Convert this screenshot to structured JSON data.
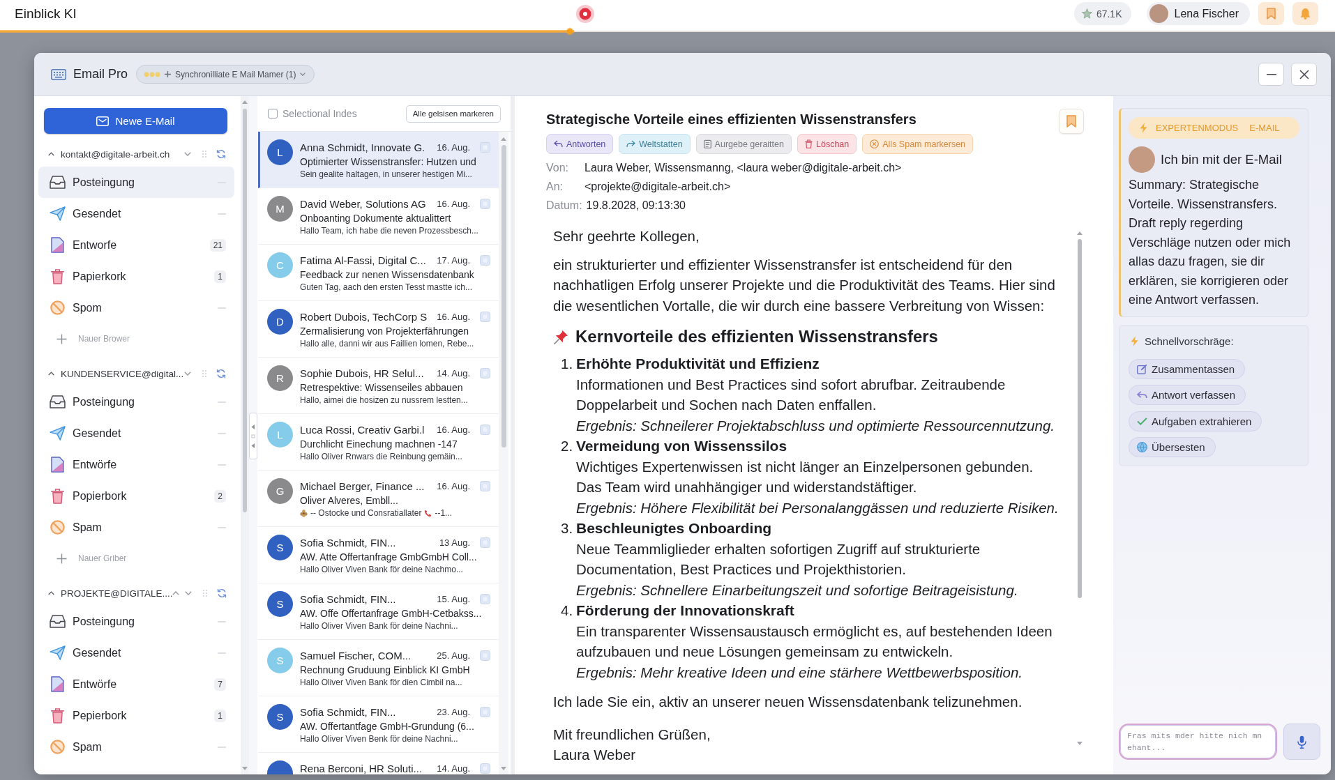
{
  "top_bar": {
    "title": "Einblick KI",
    "progress": {
      "level": 0.43
    },
    "credits": "67.1K",
    "user": {
      "name": "Lena Fischer"
    }
  },
  "window": {
    "title": "Email Pro",
    "sync_status": "Synchronilliate E Mail Mamer (1)"
  },
  "sidebar": {
    "compose_button": "Newe E-Mail",
    "accounts": [
      {
        "address": "kontakt@digitale-arbeit.ch",
        "expanded": true,
        "up_button": false,
        "folders": [
          {
            "name": "Posteingung",
            "kind": "inbox",
            "selected": true
          },
          {
            "name": "Gesendet",
            "kind": "sent",
            "selected": false
          },
          {
            "name": "Entworfe",
            "kind": "drafts",
            "count": "21",
            "selected": false
          },
          {
            "name": "Papierkork",
            "kind": "trash",
            "count": "1",
            "selected": false
          },
          {
            "name": "Spom",
            "kind": "spam",
            "selected": false
          }
        ],
        "add_folder": "Nauer Brower"
      },
      {
        "address": "KUNDENSERVICE@digital...",
        "expanded": true,
        "up_button": false,
        "folders": [
          {
            "name": "Posteingung",
            "kind": "inbox",
            "selected": false
          },
          {
            "name": "Gesendet",
            "kind": "sent",
            "selected": false
          },
          {
            "name": "Entwörfe",
            "kind": "drafts",
            "selected": false
          },
          {
            "name": "Popierbork",
            "kind": "trash",
            "count": "2",
            "selected": false
          },
          {
            "name": "Spam",
            "kind": "spam",
            "selected": false
          }
        ],
        "add_folder": "Nauer Griber"
      },
      {
        "address": "PROJEKTE@DIGITALE....",
        "expanded": true,
        "up_button": true,
        "folders": [
          {
            "name": "Posteingung",
            "kind": "inbox",
            "selected": false
          },
          {
            "name": "Gesendet",
            "kind": "sent",
            "selected": false
          },
          {
            "name": "Entwörfe",
            "kind": "drafts",
            "count": "7",
            "selected": false
          },
          {
            "name": "Pepierbork",
            "kind": "trash",
            "count": "1",
            "selected": false
          },
          {
            "name": "Spam",
            "kind": "spam",
            "selected": false
          }
        ]
      }
    ]
  },
  "email_list": {
    "select_all": {
      "label": "Selectional Indes",
      "checked": false
    },
    "mark_all_button": "Alle gelsisen markeren",
    "emails": [
      {
        "initial": "L",
        "color": "#3060c0",
        "sender": "Anna Schmidt, Innovate G.",
        "date": "16. Aug.",
        "subject": "Optimierter Wissenstransfer: Hutzen und",
        "preview": "Sein gealite haltagen, in unserer hestigen Mi...",
        "kind": "plain",
        "selected": true
      },
      {
        "initial": "M",
        "color": "#8a8a8c",
        "sender": "David Weber, Solutions AG",
        "date": "16. Aug.",
        "subject": "Onboanting Dokumente aktualittert",
        "preview": "Hallo Team, ich habe die neven Prozessbesch...",
        "kind": "plain",
        "selected": false
      },
      {
        "initial": "C",
        "color": "#84cce9",
        "sender": "Fatima Al-Fassi, Digital C...",
        "date": "17. Aug.",
        "subject": "Feedback zur nenen Wissensdatenbank",
        "preview": "Guten Tag, aach den ersten Tesst mastte ich...",
        "kind": "plain",
        "selected": false
      },
      {
        "initial": "D",
        "color": "#3060c0",
        "sender": "Robert Dubois, TechCorp S",
        "date": "16. Aug.",
        "subject": "Zermalisierung von Projekterfährungen",
        "preview": "Hallo alle, danni wir aus Faillien lomen, Rebe...",
        "kind": "plain",
        "selected": false
      },
      {
        "initial": "R",
        "color": "#8a8a8c",
        "sender": "Sophie Dubois, HR Selul...",
        "date": "14. Aug.",
        "subject": "Retrespektive: Wissenseiles abbauen",
        "preview": "Hallo, aimei die hosizen zu nussrem lestten...",
        "kind": "plain",
        "selected": false
      },
      {
        "initial": "L",
        "color": "#84cce9",
        "sender": "Luca Rossi, Creativ Garbi.l",
        "date": "16. Aug.",
        "subject": "Durchlicht Einechung machnen -147",
        "preview": "Hallo Oliver Rnwars die Reinbung gemäin...",
        "kind": "plain",
        "selected": false
      },
      {
        "initial": "G",
        "color": "#8a8a8c",
        "sender": "Michael Berger, Finance ...",
        "date": "16. Aug.",
        "subject": "Oliver Alveres, Embll...",
        "preview": "-- Ostocke und Consratiallater",
        "preview_end": "--1...",
        "kind": "icons",
        "selected": false
      },
      {
        "initial": "S",
        "color": "#3060c0",
        "sender": "Sofia Schmidt, FIN...",
        "date": "13 Aug.",
        "subject": "AW. Atte Offertanfrage GmbGmbH Coll...",
        "preview": "Hallo Oliver Viven Bank för deine Nachmo...",
        "kind": "plain",
        "selected": false
      },
      {
        "initial": "S",
        "color": "#3060c0",
        "sender": "Sofia Schmidt, FIN...",
        "date": "15. Aug.",
        "subject": "AW. Offe Offertanfrage GmbH-Cetbakss...",
        "preview": "Hallo Oliver Viven Bank för deine Nachni...",
        "kind": "plain",
        "selected": false
      },
      {
        "initial": "S",
        "color": "#84cce9",
        "sender": "Samuel Fischer, COM...",
        "date": "25. Aug.",
        "subject": "Rechnung Gruduung Einblick KI GmbH",
        "preview": "Hallo Oliver Viven Bank för dien Cimbil na...",
        "kind": "plain",
        "selected": false
      },
      {
        "initial": "S",
        "color": "#3060c0",
        "sender": "Sofia Schmidt, FIN...",
        "date": "23. Aug.",
        "subject": "AW. Offertantfage GmbH-Grundung (6...",
        "preview": "Hallo Oliver Viven Benk för deine Nachni...",
        "kind": "plain",
        "selected": false
      },
      {
        "color": "#3060c0",
        "sender": "Rena Berconi, HR Soluti...",
        "date": "14. Aug.",
        "selected": false
      }
    ]
  },
  "message": {
    "subject": "Strategische Vorteile eines effizienten Wissenstransfers",
    "actions": [
      {
        "label": "Antworten",
        "kind": "reply"
      },
      {
        "label": "Weltstatten",
        "kind": "forward"
      },
      {
        "label": "Aurgebe geraitten",
        "kind": "task"
      },
      {
        "label": "Löschan",
        "kind": "delete"
      },
      {
        "label": "Alls Spam markersen",
        "kind": "spam"
      }
    ],
    "headers": [
      {
        "label": "Von:",
        "value": "Laura Weber, Wissensmanng, <laura weber@digitale-arbeit.ch>"
      },
      {
        "label": "An:",
        "value": "<projekte@digitale-arbeit.ch>"
      },
      {
        "label": "Datum:",
        "value": "19.8.2028, 09:13:30"
      }
    ],
    "body": {
      "greeting": "Sehr geehrte Kollegen,",
      "intro": "ein strukturierter und effizienter Wissenstransfer ist entscheidend für den nachhatligen Erfolg unserer Projekte und die Produktivität des Teams. Hier sind die wesentlichen Vortalle, die wir durch eine bassere Verbreitung von Wissen:",
      "heading": "Kernvorteile des effizienten Wissenstransfers",
      "points": [
        {
          "number": "1.",
          "title": "Erhöhte Produktivität und Effizienz",
          "text": "Informationen und Best Practices sind sofort abrufbar. Zeitraubende Doppelarbeit und Sochen nach Daten enffallen.",
          "result": "Ergebnis: Schneilerer Projektabschluss und optimierte Ressourcennutzung."
        },
        {
          "number": "2.",
          "title": "Vermeidung von Wissenssilos",
          "text": "Wichtiges Expertenwissen ist nicht länger an Einzelpersonen gebunden. Das Team wird unahhängiger und widerstandstäftiger.",
          "result": "Ergebnis: Höhere Flexibilität bei Personalanggässen und reduzierte Risiken."
        },
        {
          "number": "3.",
          "title": "Beschleunigtes Onboarding",
          "text": "Neue Teammliglieder erhalten sofortigen Zugriff auf strukturierte Documentation, Best Practices und Projekthistorien.",
          "result": "Ergebnis: Schnellere Einarbeitungszeit und sofortige Beitrageisistung."
        },
        {
          "number": "4.",
          "title": "Förderung der Innovationskraft",
          "text": "Ein transparenter Wissensaustausch ermöglicht es, auf bestehenden Ideen aufzubauen und neue Lösungen gemeinsam zu entwickeln.",
          "result": "Ergebnis: Mehr kreative Ideen und eine stärhere Wettbewerbsposition."
        }
      ],
      "invitation": "Ich lade Sie ein, aktiv an unserer neuen Wissensdatenbank telizunehmen.",
      "closing": "Mit freundlichen Grüßen,",
      "signature": "Laura Weber"
    }
  },
  "assistant": {
    "mode_badge": {
      "mode": "EXPERTENMODUS",
      "context": "E-MAIL"
    },
    "greeting": "Ich bin mit der E-Mail",
    "summary": "Summary: Strategische Vorteile. Wissenstransfers. Draft reply regerding Verschläge nutzen oder mich allas dazu fragen, sie dir erklären, sie korrigieren oder eine Antwort verfassen.",
    "quick_title": "Schnellvorschräge:",
    "suggestions": [
      {
        "label": "Zusammentassen",
        "kind": "summarize"
      },
      {
        "label": "Antwort verfassen",
        "kind": "reply"
      },
      {
        "label": "Aufgaben extrahieren",
        "kind": "tasks"
      },
      {
        "label": "Übersesten",
        "kind": "translate"
      }
    ],
    "input": {
      "placeholder": "Fras mits mder hitte nich mn ehant..."
    }
  }
}
